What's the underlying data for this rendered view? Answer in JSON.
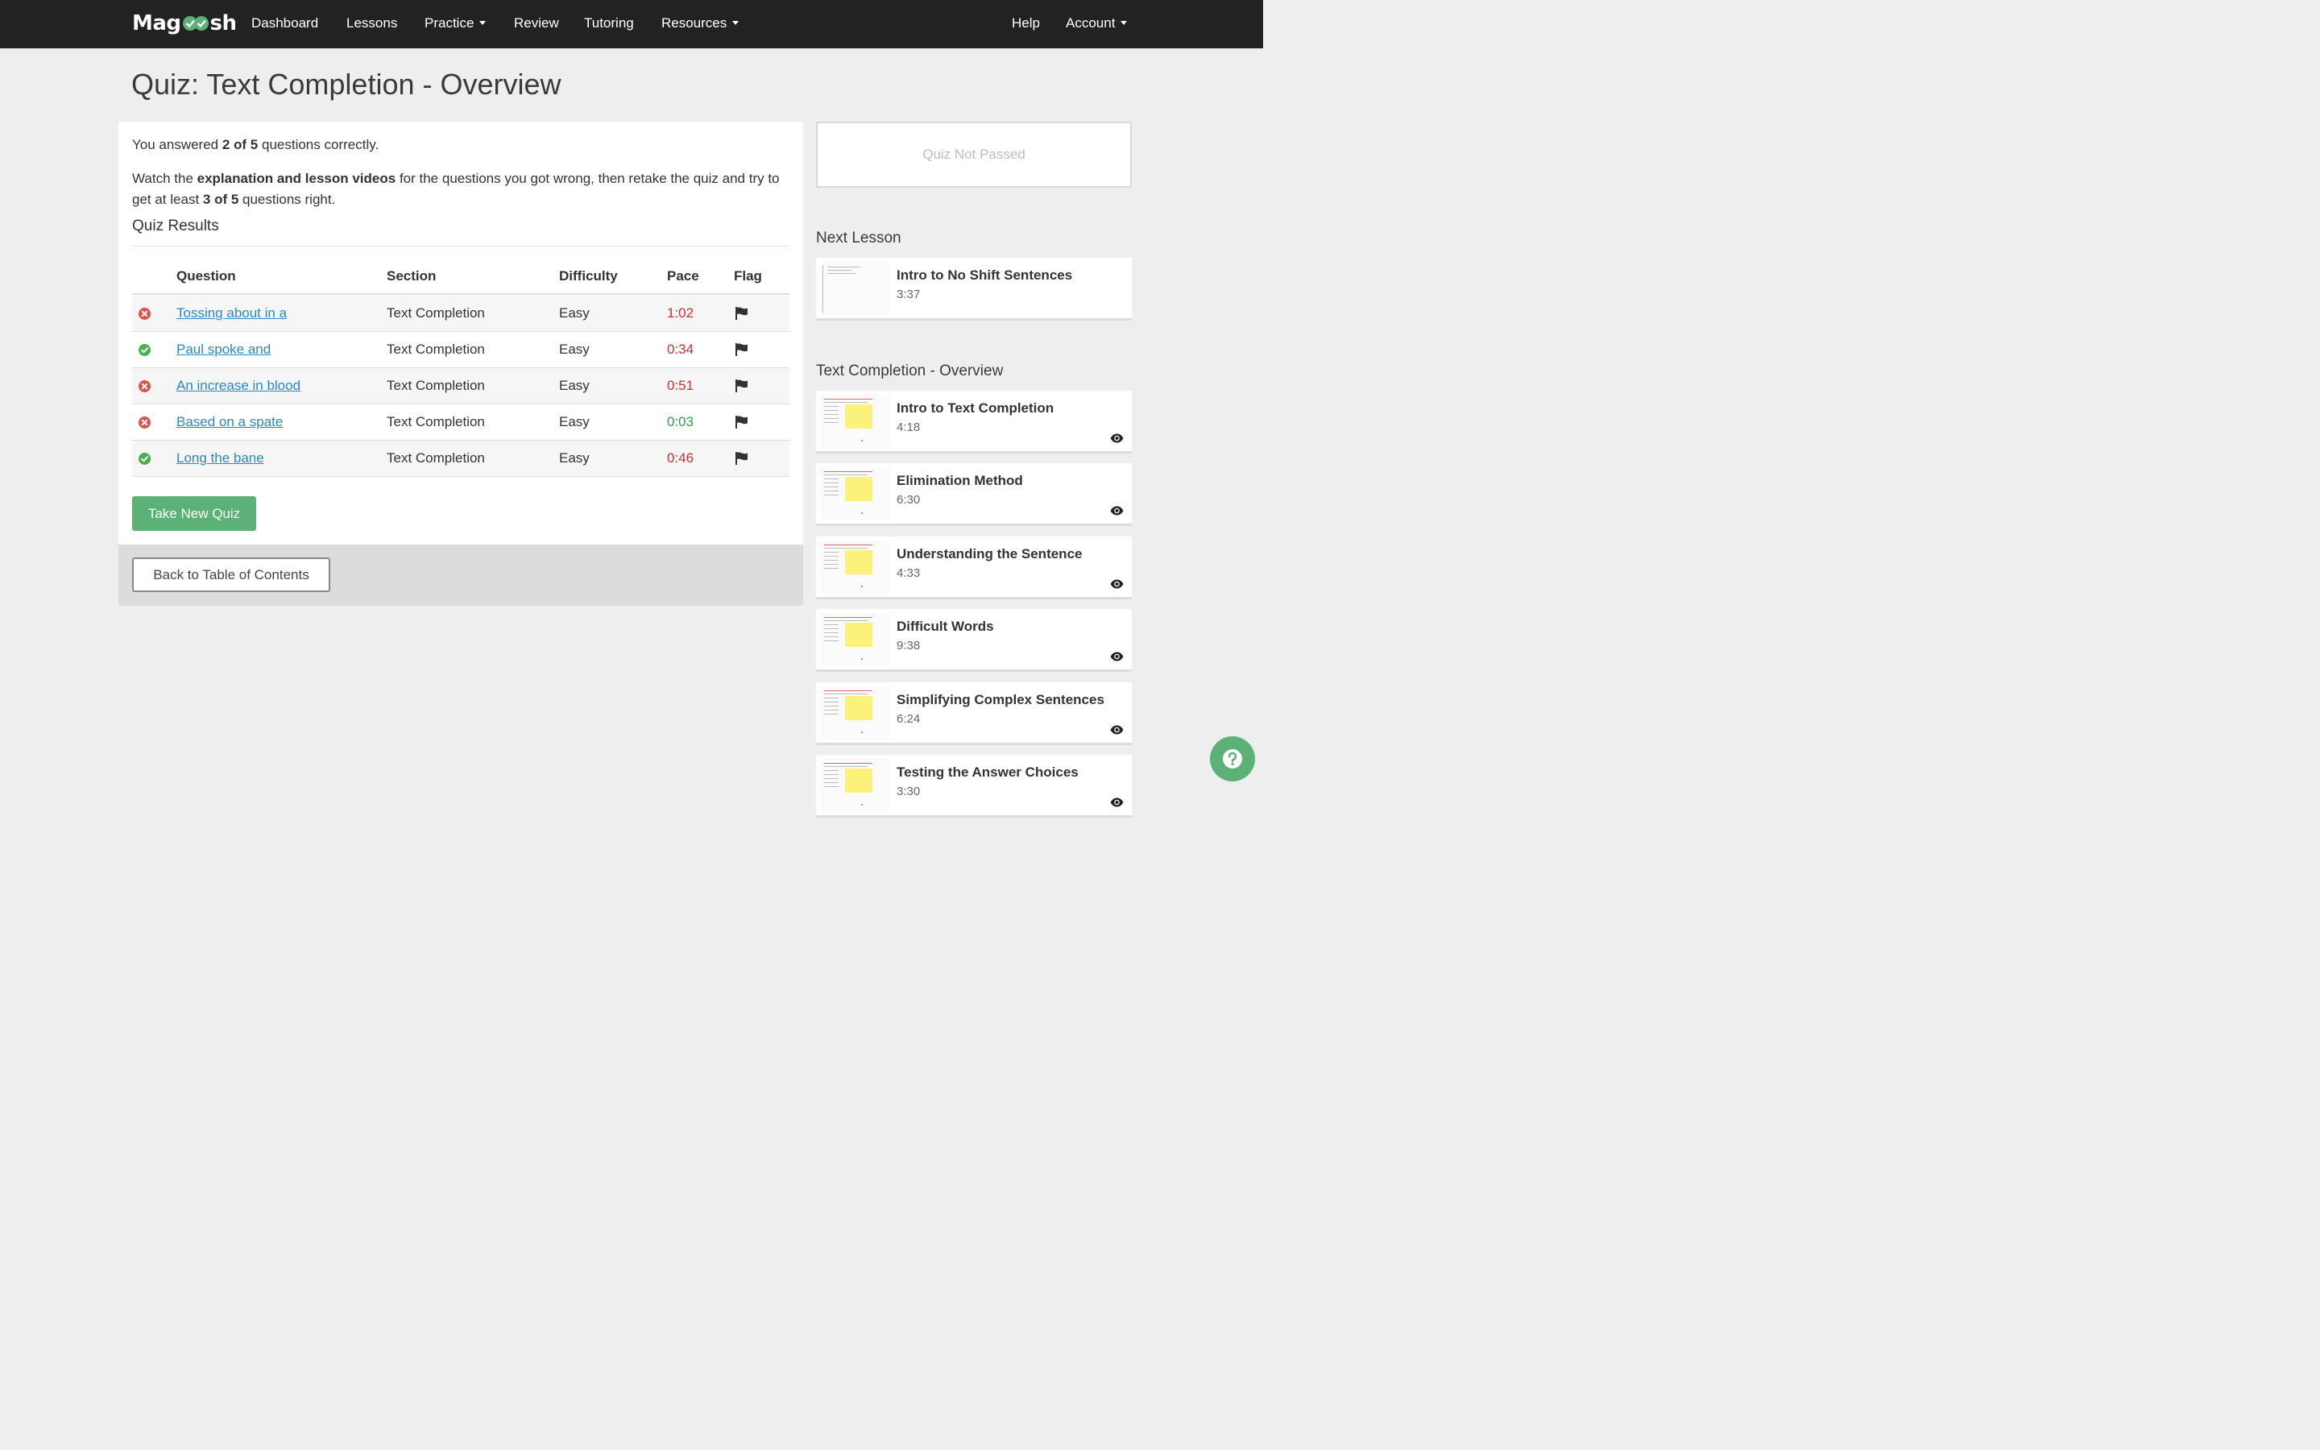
{
  "nav": {
    "logo_part1": "Mag",
    "logo_part2": "sh",
    "links": {
      "dashboard": "Dashboard",
      "lessons": "Lessons",
      "practice": "Practice",
      "review": "Review",
      "tutoring": "Tutoring",
      "resources": "Resources",
      "help": "Help",
      "account": "Account"
    }
  },
  "page_title": "Quiz: Text Completion - Overview",
  "summary": {
    "p1_before": "You answered ",
    "p1_score": "2 of 5",
    "p1_after": " questions correctly.",
    "p2_a": "Watch the ",
    "p2_b": "explanation and lesson videos",
    "p2_c": " for the questions you got wrong, then retake the quiz and try to get at least ",
    "p2_d": "3 of 5",
    "p2_e": " questions right."
  },
  "results": {
    "heading": "Quiz Results",
    "columns": [
      "Question",
      "Section",
      "Difficulty",
      "Pace",
      "Flag"
    ],
    "rows": [
      {
        "status": "wrong",
        "question": "Tossing about in a",
        "section": "Text Completion",
        "difficulty": "Easy",
        "pace": "1:02",
        "pace_color": "red"
      },
      {
        "status": "correct",
        "question": "Paul spoke and",
        "section": "Text Completion",
        "difficulty": "Easy",
        "pace": "0:34",
        "pace_color": "red"
      },
      {
        "status": "wrong",
        "question": "An increase in blood",
        "section": "Text Completion",
        "difficulty": "Easy",
        "pace": "0:51",
        "pace_color": "red"
      },
      {
        "status": "wrong",
        "question": "Based on a spate",
        "section": "Text Completion",
        "difficulty": "Easy",
        "pace": "0:03",
        "pace_color": "green"
      },
      {
        "status": "correct",
        "question": "Long the bane",
        "section": "Text Completion",
        "difficulty": "Easy",
        "pace": "0:46",
        "pace_color": "red"
      }
    ]
  },
  "buttons": {
    "take_new_quiz": "Take New Quiz",
    "back_to_toc": "Back to Table of Contents"
  },
  "sidebar": {
    "quiz_status": "Quiz Not Passed",
    "next_lesson_heading": "Next Lesson",
    "next_lesson": {
      "title": "Intro to No Shift Sentences",
      "duration": "3:37"
    },
    "section_heading": "Text Completion - Overview",
    "lessons": [
      {
        "title": "Intro to Text Completion",
        "duration": "4:18"
      },
      {
        "title": "Elimination Method",
        "duration": "6:30"
      },
      {
        "title": "Understanding the Sentence",
        "duration": "4:33"
      },
      {
        "title": "Difficult Words",
        "duration": "9:38"
      },
      {
        "title": "Simplifying Complex Sentences",
        "duration": "6:24"
      },
      {
        "title": "Testing the Answer Choices",
        "duration": "3:30"
      }
    ]
  },
  "colors": {
    "nav_bg": "#222222",
    "brand_green": "#5cb176",
    "link_blue": "#2a88c4",
    "wrong_red": "#d9534f",
    "correct_green": "#4cae4c"
  },
  "icons": [
    "check-logo-icon",
    "caret-down-icon",
    "wrong-icon",
    "correct-icon",
    "flag-icon",
    "eye-icon",
    "question-help-icon"
  ]
}
